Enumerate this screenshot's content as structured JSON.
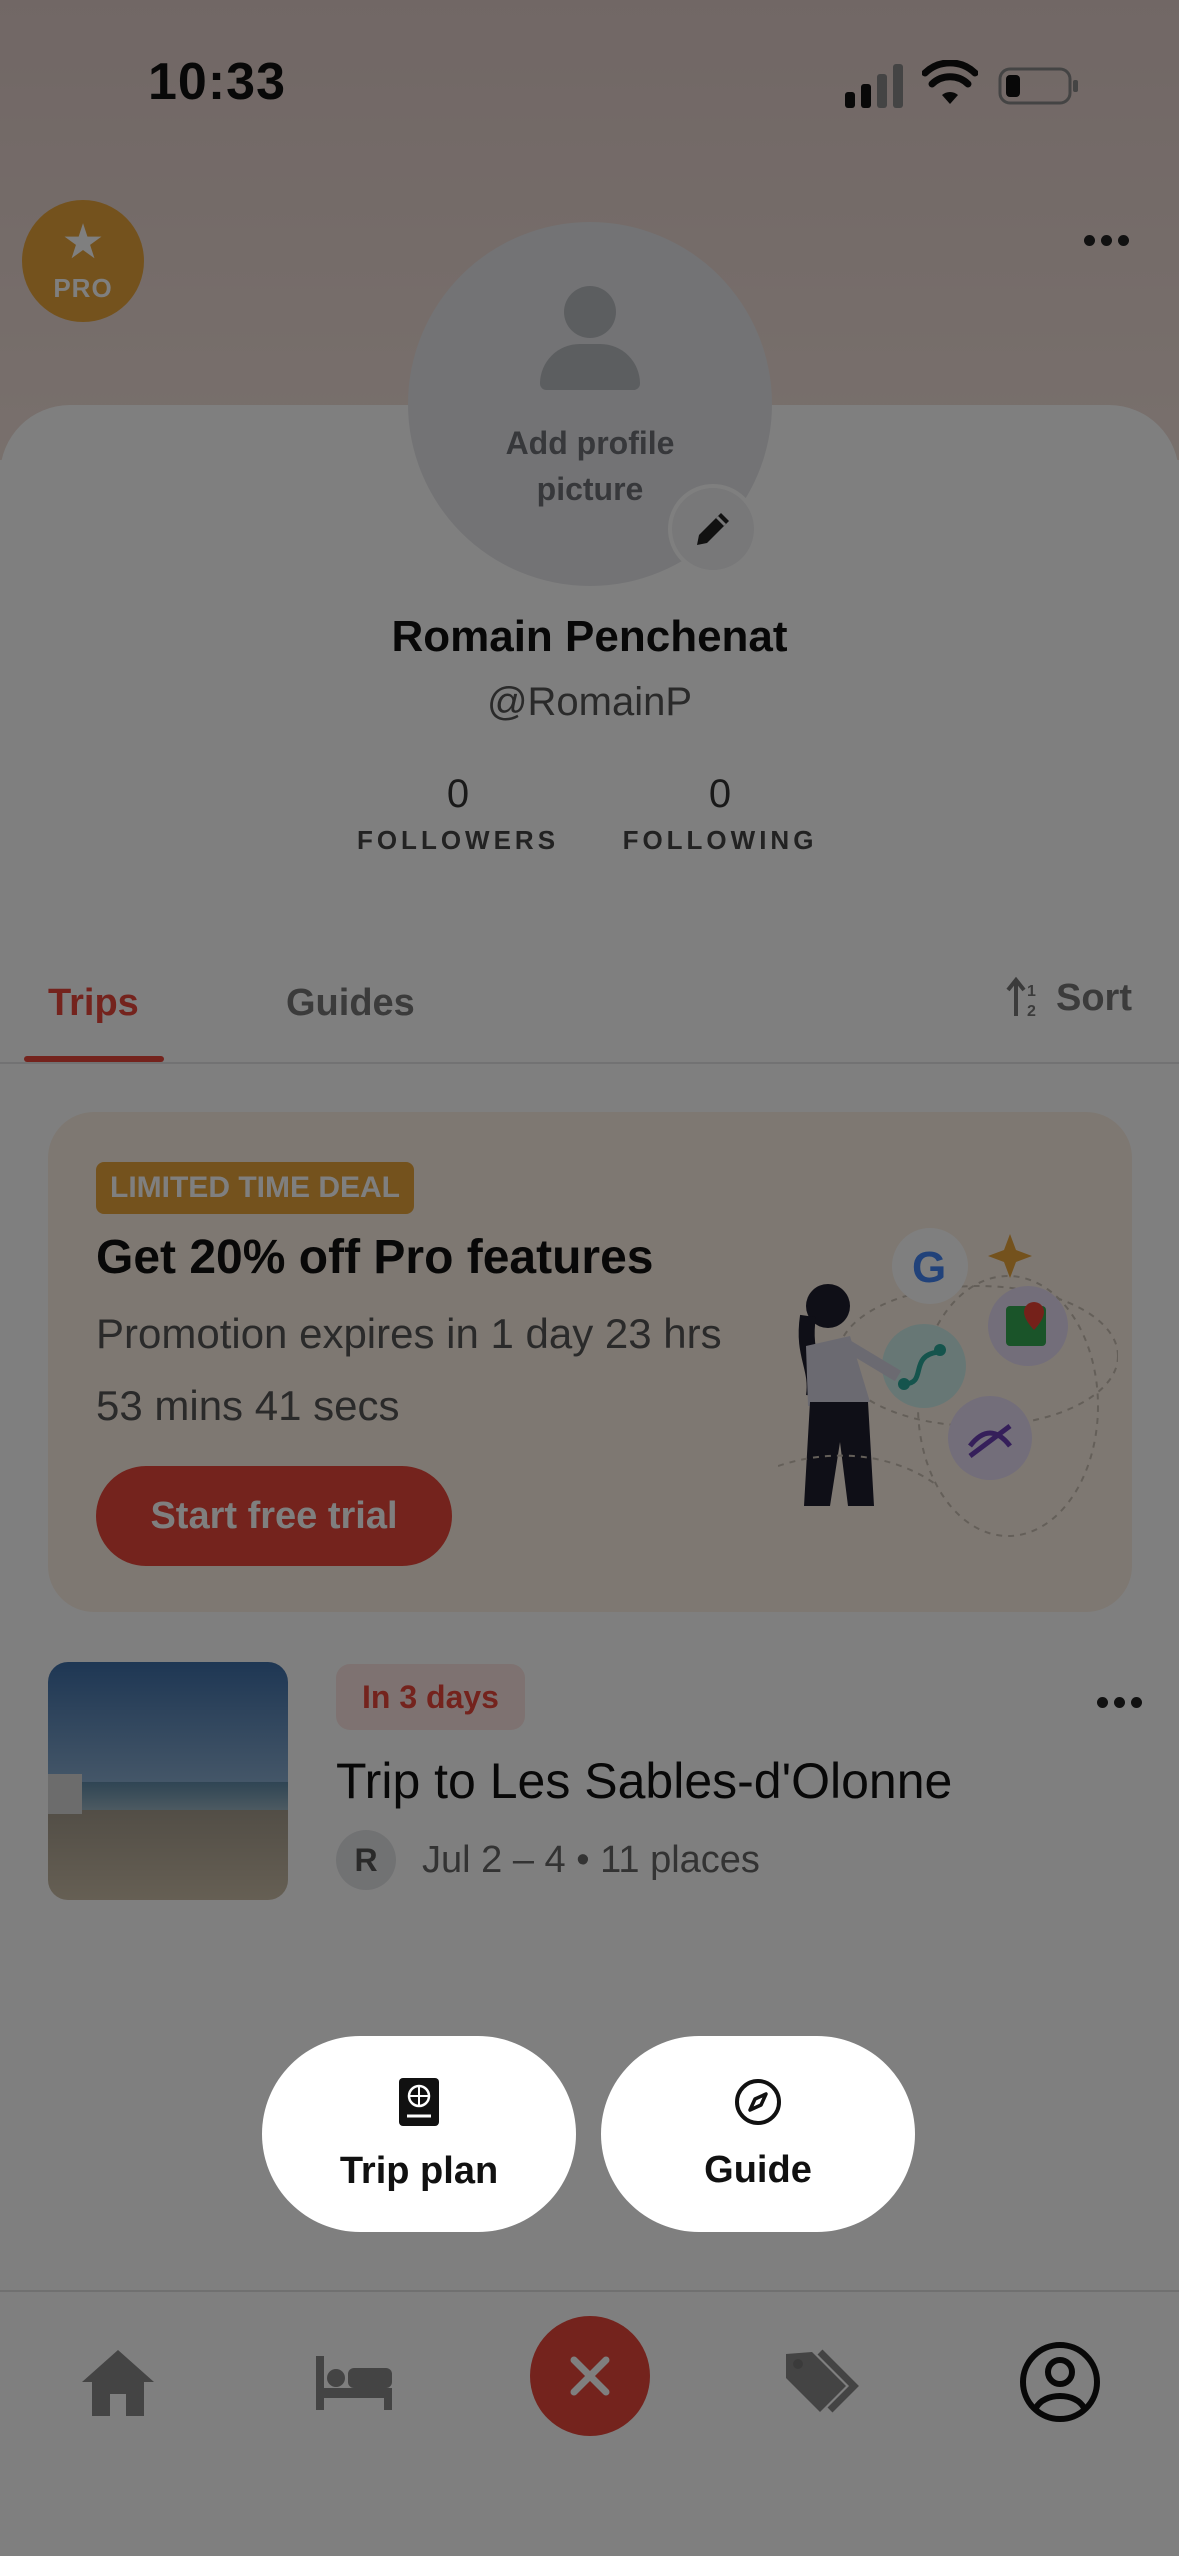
{
  "status_bar": {
    "time": "10:33"
  },
  "header": {
    "pro_badge": "PRO"
  },
  "profile": {
    "add_picture": "Add profile picture",
    "name": "Romain Penchenat",
    "handle": "@RomainP",
    "followers_count": "0",
    "followers_label": "FOLLOWERS",
    "following_count": "0",
    "following_label": "FOLLOWING"
  },
  "tabs": {
    "trips": "Trips",
    "guides": "Guides",
    "sort": "Sort"
  },
  "promo": {
    "badge": "LIMITED TIME DEAL",
    "title": "Get 20% off Pro features",
    "subtitle": "Promotion expires in 1 day 23 hrs 53 mins 41 secs",
    "button": "Start free trial"
  },
  "trip": {
    "badge": "In 3 days",
    "title": "Trip to Les Sables-d'Olonne",
    "avatar_initial": "R",
    "meta": "Jul 2 –  4 • 11 places"
  },
  "create_menu": {
    "trip_plan": "Trip plan",
    "guide": "Guide"
  },
  "colors": {
    "accent": "#e8473a",
    "pro": "#e9a53a",
    "promo_bg": "#fdf0e4"
  },
  "icons": {
    "nav": [
      "home-icon",
      "bed-icon",
      "close-icon",
      "tags-icon",
      "profile-icon"
    ]
  }
}
